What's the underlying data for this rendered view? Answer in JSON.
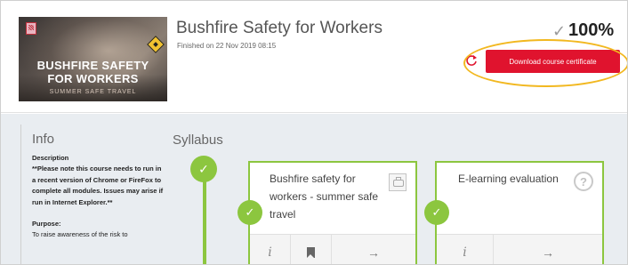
{
  "header": {
    "banner": {
      "line1": "BUSHFIRE SAFETY",
      "line2": "FOR WORKERS",
      "line3": "SUMMER SAFE TRAVEL"
    },
    "title": "Bushfire Safety for Workers",
    "finished": "Finished on 22 Nov 2019 08:15",
    "progress_check": "✓",
    "progress": "100%",
    "certificate_button": "Download course certificate",
    "refresh_icon": "refresh-icon"
  },
  "info": {
    "title": "Info",
    "description_heading": "Description",
    "description": "**Please note this course needs to run in a recent version of Chrome or FireFox to complete all modules. Issues may arise if run in Internet Explorer.**",
    "purpose_heading": "Purpose:",
    "purpose": "To raise awareness of the risk to"
  },
  "syllabus": {
    "title": "Syllabus",
    "check": "✓",
    "modules": [
      {
        "title": "Bushfire safety for workers - summer safe travel",
        "check": "✓",
        "icon": "course-icon",
        "footer": [
          "i",
          "bookmark-icon",
          "→"
        ]
      },
      {
        "title": "E-learning evaluation",
        "check": "✓",
        "icon": "question-icon",
        "icon_text": "?",
        "footer": [
          "i",
          "→"
        ]
      }
    ]
  },
  "colors": {
    "accent_green": "#8cc63f",
    "button_red": "#e0132e",
    "highlight": "#f2b820",
    "body_bg": "#e9edf1"
  }
}
